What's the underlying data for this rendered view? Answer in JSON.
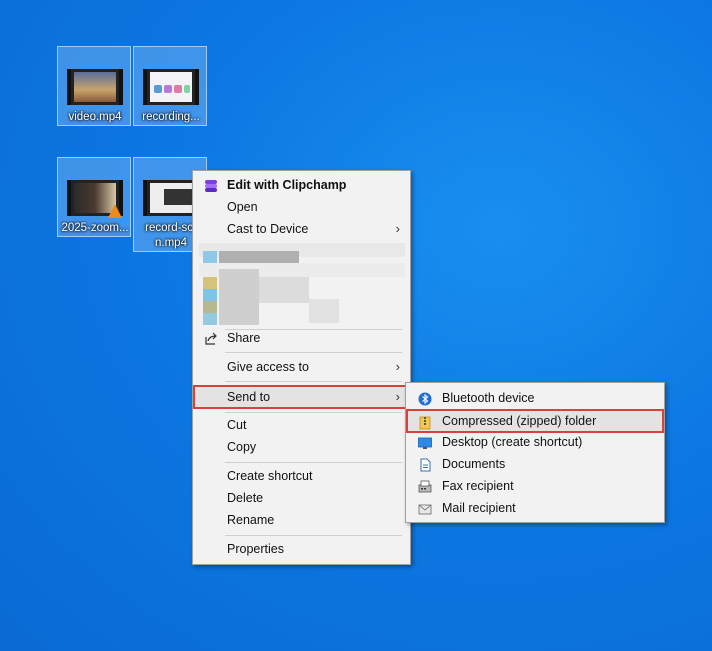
{
  "desktop": {
    "icons": [
      {
        "label": "video.mp4"
      },
      {
        "label": "recording..."
      },
      {
        "label": "2025-zoom..."
      },
      {
        "label_line1": "record-scr",
        "label_line2": "n.mp4"
      }
    ]
  },
  "context_menu": {
    "edit_clipchamp": "Edit with Clipchamp",
    "open": "Open",
    "cast": "Cast to Device",
    "share": "Share",
    "give_access": "Give access to",
    "send_to": "Send to",
    "cut": "Cut",
    "copy": "Copy",
    "create_shortcut": "Create shortcut",
    "delete": "Delete",
    "rename": "Rename",
    "properties": "Properties"
  },
  "send_to_menu": {
    "bluetooth": "Bluetooth device",
    "compressed": "Compressed (zipped) folder",
    "desktop": "Desktop (create shortcut)",
    "documents": "Documents",
    "fax": "Fax recipient",
    "mail": "Mail recipient"
  },
  "colors": {
    "desktop_bg": "#0d78e2",
    "highlight_outline": "#d9413b",
    "menu_bg": "#f2f2f2"
  },
  "icons": [
    "video-thumbnail-icon",
    "clipchamp-icon",
    "share-icon",
    "bluetooth-icon",
    "zip-folder-icon",
    "desktop-icon",
    "documents-icon",
    "fax-icon",
    "mail-icon",
    "chevron-right-icon"
  ]
}
